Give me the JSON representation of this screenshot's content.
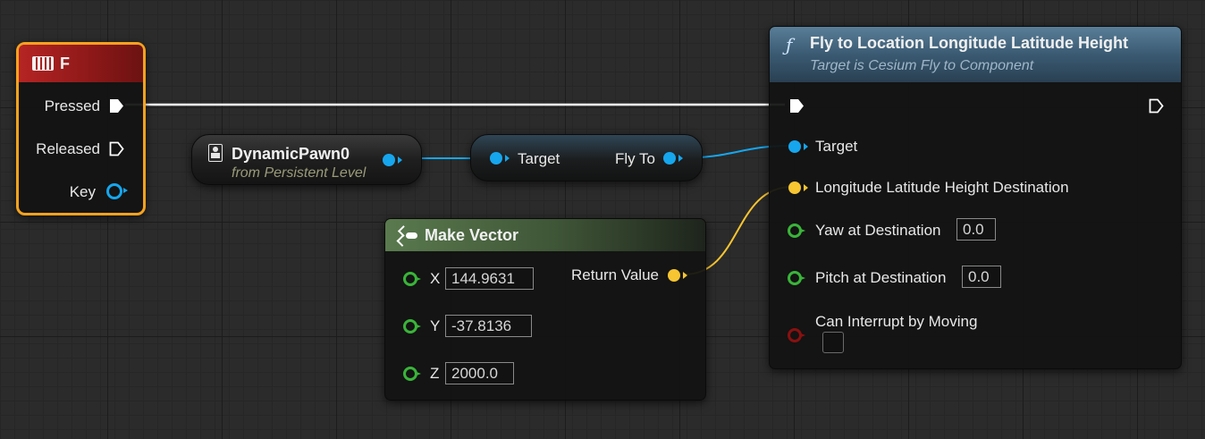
{
  "input_event_node": {
    "title": "F",
    "pins": {
      "pressed": "Pressed",
      "released": "Released",
      "key": "Key"
    },
    "icon": "keyboard-icon",
    "header_color": "#a01c1c",
    "selected_outline_color": "#f5a21f"
  },
  "pawn_node": {
    "title": "DynamicPawn0",
    "subtitle": "from Persistent Level",
    "icon": "pawn-icon"
  },
  "get_component_node": {
    "input_label": "Target",
    "output_label": "Fly To"
  },
  "make_vector_node": {
    "title": "Make Vector",
    "icon": "make-vector-icon",
    "header_color": "#4a6a40",
    "inputs": [
      {
        "label": "X",
        "value": "144.9631"
      },
      {
        "label": "Y",
        "value": "-37.8136"
      },
      {
        "label": "Z",
        "value": "2000.0"
      }
    ],
    "output_label": "Return Value"
  },
  "fly_node": {
    "title": "Fly to Location Longitude Latitude Height",
    "subtitle": "Target is Cesium Fly to Component",
    "icon": "function-icon",
    "header_color": "#3c5a72",
    "target_label": "Target",
    "destination_label": "Longitude Latitude Height Destination",
    "yaw_label": "Yaw at Destination",
    "yaw_value": "0.0",
    "pitch_label": "Pitch at Destination",
    "pitch_value": "0.0",
    "interrupt_label": "Can Interrupt by Moving",
    "interrupt_checked": false
  },
  "colors": {
    "exec_wire": "#ffffff",
    "object_pin": "#16a6ee",
    "vector_pin": "#f7c531",
    "float_pin": "#3ab43a",
    "bool_pin": "#8a1010"
  }
}
